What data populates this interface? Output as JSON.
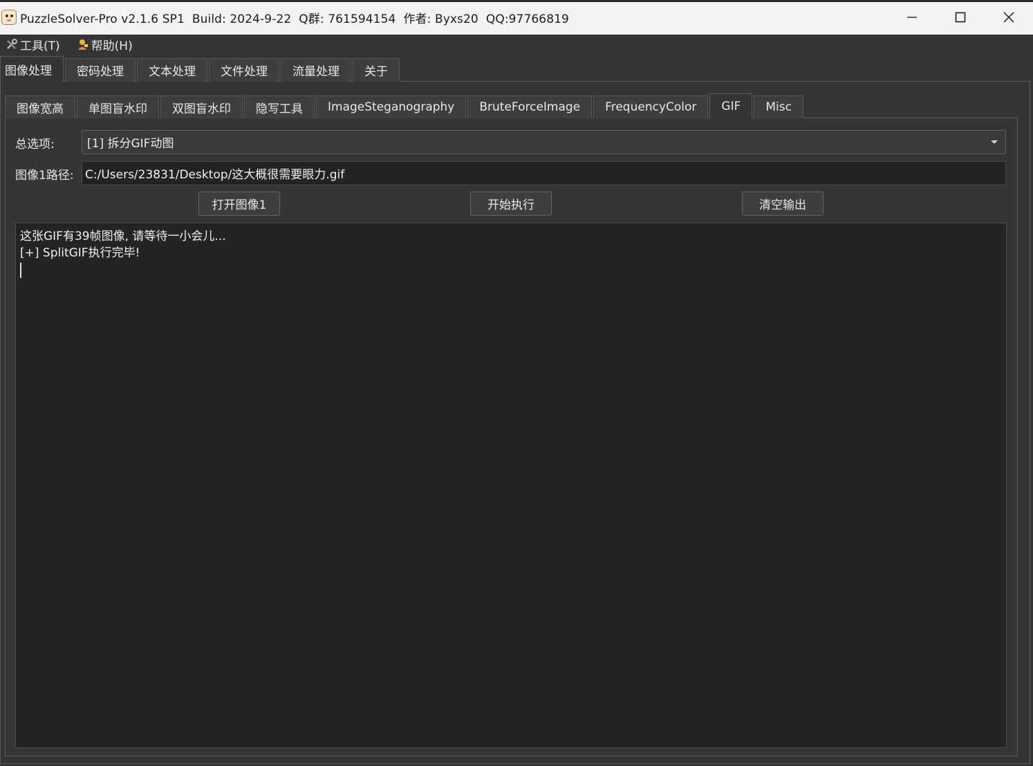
{
  "window": {
    "title": "PuzzleSolver-Pro v2.1.6 SP1  Build: 2024-9-22  Q群: 761594154  作者: Byxs20  QQ:97766819"
  },
  "menu": [
    {
      "label": "工具(T)",
      "icon": "tools-icon"
    },
    {
      "label": "帮助(H)",
      "icon": "person-icon"
    }
  ],
  "outer_tabs": [
    "图像处理",
    "密码处理",
    "文本处理",
    "文件处理",
    "流量处理",
    "关于"
  ],
  "outer_active": "图像处理",
  "inner_tabs": [
    "图像宽高",
    "单图盲水印",
    "双图盲水印",
    "隐写工具",
    "ImageSteganography",
    "BruteForceImage",
    "FrequencyColor",
    "GIF",
    "Misc"
  ],
  "inner_active": "GIF",
  "form": {
    "option_label": "总选项:",
    "option_value": "[1] 拆分GIF动图",
    "path_label": "图像1路径:",
    "path_value": "C:/Users/23831/Desktop/这大概很需要眼力.gif"
  },
  "buttons": {
    "open": "打开图像1",
    "run": "开始执行",
    "clear": "清空输出"
  },
  "output": {
    "lines": [
      "这张GIF有39帧图像, 请等待一小会儿...",
      "[+] SplitGIF执行完毕!"
    ]
  }
}
